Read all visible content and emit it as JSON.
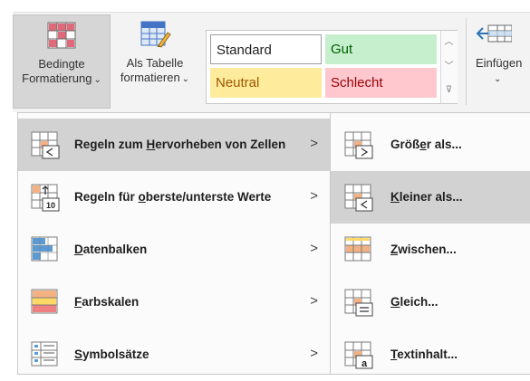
{
  "ribbon": {
    "conditional_formatting": {
      "line1": "Bedingte",
      "line2": "Formatierung"
    },
    "format_as_table": {
      "line1": "Als Tabelle",
      "line2": "formatieren"
    },
    "insert": {
      "line1": "Einfügen"
    },
    "cell_styles": {
      "standard": "Standard",
      "gut": "Gut",
      "neutral": "Neutral",
      "schlecht": "Schlecht"
    }
  },
  "menu": {
    "items": [
      {
        "pre": "Regeln zum ",
        "key": "H",
        "post": "ervorheben von Zellen",
        "icon": "highlight-cells-rules-icon"
      },
      {
        "pre": "Regeln für ",
        "key": "o",
        "post": "berste/unterste Werte",
        "icon": "top-bottom-rules-icon"
      },
      {
        "pre": "",
        "key": "D",
        "post": "atenbalken",
        "icon": "data-bars-icon"
      },
      {
        "pre": "",
        "key": "F",
        "post": "arbskalen",
        "icon": "color-scales-icon"
      },
      {
        "pre": "",
        "key": "S",
        "post": "ymbolsätze",
        "icon": "icon-sets-icon"
      }
    ]
  },
  "submenu": {
    "items": [
      {
        "pre": "Größ",
        "key": "e",
        "post": "r als...",
        "icon": "greater-than-icon"
      },
      {
        "pre": "",
        "key": "K",
        "post": "leiner als...",
        "icon": "less-than-icon"
      },
      {
        "pre": "",
        "key": "Z",
        "post": "wischen...",
        "icon": "between-icon"
      },
      {
        "pre": "",
        "key": "G",
        "post": "leich...",
        "icon": "equal-to-icon"
      },
      {
        "pre": "",
        "key": "T",
        "post": "extinhalt...",
        "icon": "text-contains-icon"
      }
    ]
  }
}
